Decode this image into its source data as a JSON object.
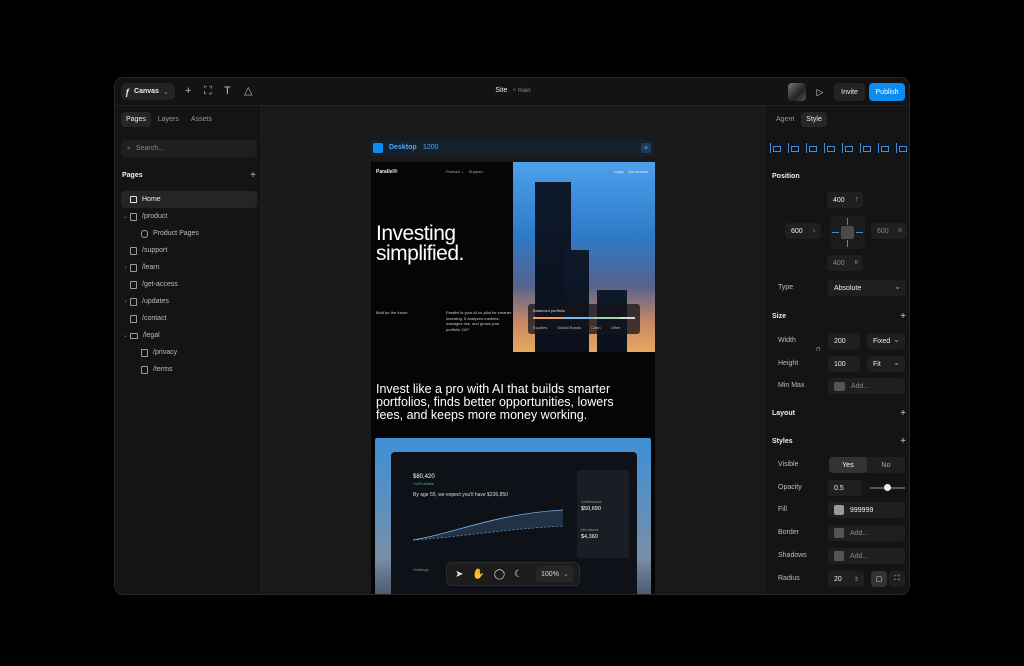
{
  "topbar": {
    "canvas_label": "Canvas",
    "site_label": "Site",
    "branch": "main",
    "invite": "Invite",
    "publish": "Publish"
  },
  "left_panel": {
    "tabs": [
      "Pages",
      "Layers",
      "Assets"
    ],
    "search_placeholder": "Search...",
    "pages_heading": "Pages",
    "pages": [
      {
        "label": "Home",
        "icon": "home-icon",
        "selected": true
      },
      {
        "label": "/product",
        "icon": "page-icon",
        "expanded": true
      },
      {
        "label": "Product Pages",
        "icon": "database-icon"
      },
      {
        "label": "/support",
        "icon": "page-icon"
      },
      {
        "label": "/learn",
        "icon": "page-icon"
      },
      {
        "label": "/get-access",
        "icon": "page-icon"
      },
      {
        "label": "/updates",
        "icon": "page-icon"
      },
      {
        "label": "/contact",
        "icon": "page-icon"
      },
      {
        "label": "/legal",
        "icon": "folder-icon",
        "expanded": true
      },
      {
        "label": "/privacy",
        "icon": "page-icon"
      },
      {
        "label": "/terms",
        "icon": "page-icon"
      }
    ]
  },
  "canvas": {
    "frame_name": "Desktop",
    "frame_width": "1200",
    "site": {
      "brand": "Parallel®",
      "nav_links": "Product ⌄    Support",
      "nav_right": "Login    Get access",
      "hero_title_1": "Investing",
      "hero_title_2": "simplified.",
      "tagline": "Built for the future.",
      "hero_body": "Parallel is your AI co-pilot for smarter investing. It analyzes markets, manages risk, and grows your portfolio 24/7.",
      "portfolio_title": "Balanced portfolio",
      "portfolio_legend": [
        "Equities",
        "Global Bonds",
        "Cash",
        "Other"
      ],
      "pitch": "Invest like a pro with AI that builds smarter portfolios, finds better opportunities, lowers fees, and keeps more money working.",
      "dash_balance": "$80,420",
      "dash_gain": "+12% all time",
      "dash_expect": "By age 55, we expect you'll have $236,850",
      "dash_contrib": "$50,690",
      "dash_contrib_label": "Contributions",
      "dash_return": "$4,360",
      "dash_return_label": "Net returns",
      "dash_holdings": "Holdings"
    },
    "zoom": "100%"
  },
  "right_panel": {
    "tabs": [
      "Agent",
      "Style"
    ],
    "position": {
      "heading": "Position",
      "top": "400",
      "top_sfx": "T",
      "left": "600",
      "left_sfx": "L",
      "right": "600",
      "right_sfx": "R",
      "bottom": "400",
      "bottom_sfx": "B",
      "type_label": "Type",
      "type_value": "Absolute"
    },
    "size": {
      "heading": "Size",
      "width_label": "Width",
      "width_value": "200",
      "width_mode": "Fixed",
      "height_label": "Height",
      "height_value": "100",
      "height_mode": "Fit",
      "minmax_label": "Min Max",
      "minmax_placeholder": "Add..."
    },
    "layout_heading": "Layout",
    "styles": {
      "heading": "Styles",
      "visible_label": "Visible",
      "visible_yes": "Yes",
      "visible_no": "No",
      "opacity_label": "Opacity",
      "opacity_value": "0.5",
      "fill_label": "Fill",
      "fill_value": "999999",
      "fill_color": "#999999",
      "border_label": "Border",
      "border_placeholder": "Add...",
      "shadows_label": "Shadows",
      "shadows_placeholder": "Add...",
      "radius_label": "Radius",
      "radius_value": "20"
    }
  },
  "colors": {
    "accent": "#0a8cf0",
    "panel": "#141414",
    "canvas": "#191919"
  }
}
